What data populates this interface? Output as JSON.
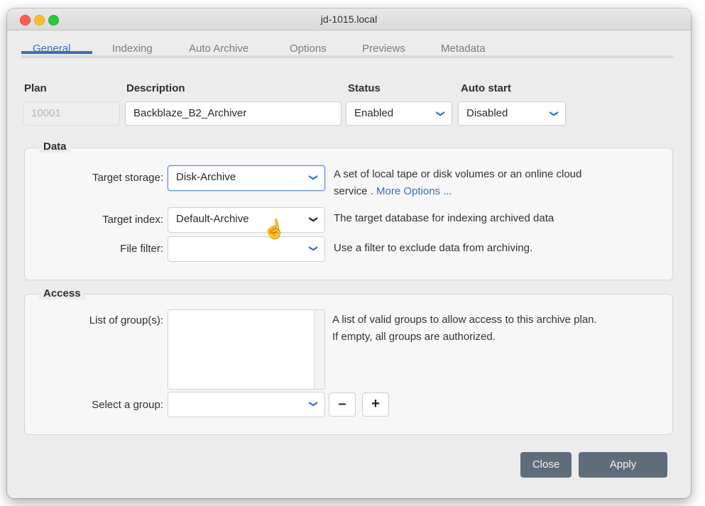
{
  "window": {
    "title": "jd-1015.local"
  },
  "tabs": [
    "General",
    "Indexing",
    "Auto Archive",
    "Options",
    "Previews",
    "Metadata"
  ],
  "headers": {
    "plan": "Plan",
    "description": "Description",
    "status": "Status",
    "auto_start": "Auto start"
  },
  "fields": {
    "plan": "10001",
    "description": "Backblaze_B2_Archiver",
    "status": "Enabled",
    "auto_start": "Disabled"
  },
  "data_group": {
    "title": "Data",
    "target_storage_label": "Target storage:",
    "target_storage_value": "Disk-Archive",
    "target_storage_desc": "A set of local tape or disk volumes or an online cloud",
    "target_storage_desc2": "service . ",
    "more_options": "More Options ...",
    "target_index_label": "Target index:",
    "target_index_value": "Default-Archive",
    "target_index_desc": "The target database for indexing archived data",
    "file_filter_label": "File filter:",
    "file_filter_value": "",
    "file_filter_desc": "Use a filter to exclude data from archiving."
  },
  "access_group": {
    "title": "Access",
    "list_label": "List of group(s):",
    "list_desc1": "A list of valid groups to allow access to this archive plan.",
    "list_desc2": "If empty, all groups are authorized.",
    "select_label": "Select a group:",
    "remove_symbol": "–",
    "add_symbol": "+"
  },
  "buttons": {
    "close": "Close",
    "apply": "Apply"
  },
  "icons": {
    "chevron": "❯",
    "cursor": "☝"
  }
}
